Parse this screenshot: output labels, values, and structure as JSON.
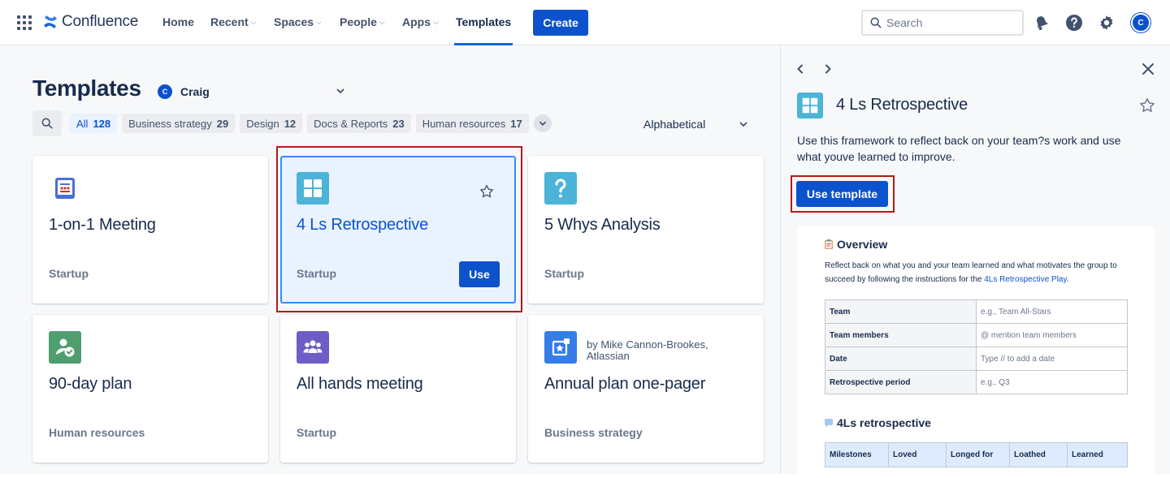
{
  "nav": {
    "logo_text": "Confluence",
    "items": [
      {
        "label": "Home"
      },
      {
        "label": "Recent"
      },
      {
        "label": "Spaces"
      },
      {
        "label": "People"
      },
      {
        "label": "Apps"
      },
      {
        "label": "Templates"
      }
    ],
    "create_label": "Create",
    "search_placeholder": "Search",
    "avatar_initial": "C"
  },
  "page": {
    "title": "Templates",
    "space_avatar": "C",
    "space_name": "Craig",
    "sort_label": "Alphabetical"
  },
  "filters": [
    {
      "label": "All",
      "count": "128"
    },
    {
      "label": "Business strategy",
      "count": "29"
    },
    {
      "label": "Design",
      "count": "12"
    },
    {
      "label": "Docs & Reports",
      "count": "23"
    },
    {
      "label": "Human resources",
      "count": "17"
    }
  ],
  "cards": [
    {
      "title": "1-on-1 Meeting",
      "category": "Startup",
      "icon": "meeting-board-icon"
    },
    {
      "title": "4 Ls Retrospective",
      "category": "Startup",
      "icon": "grid-icon",
      "use_label": "Use"
    },
    {
      "title": "5 Whys Analysis",
      "category": "Startup",
      "icon": "question-icon"
    },
    {
      "title": "90-day plan",
      "category": "Human resources",
      "icon": "person-check-icon"
    },
    {
      "title": "All hands meeting",
      "category": "Startup",
      "icon": "people-icon"
    },
    {
      "title": "Annual plan one-pager",
      "category": "Business strategy",
      "icon": "star-board-icon",
      "author": "by Mike Cannon-Brookes, Atlassian"
    }
  ],
  "panel": {
    "title": "4 Ls Retrospective",
    "description": "Use this framework to reflect back on your team?s work and use what youve learned to improve.",
    "use_template_label": "Use template",
    "preview": {
      "overview_heading": "Overview",
      "overview_text_1": "Reflect back on what you and your team learned and what motivates the group to succeed by following the instructions for the ",
      "overview_link": "4Ls Retrospective Play",
      "overview_text_2": ".",
      "table": [
        {
          "key": "Team",
          "value": "e.g., Team All-Stars"
        },
        {
          "key": "Team members",
          "value": "@ mention team members"
        },
        {
          "key": "Date",
          "value": "Type // to add a date"
        },
        {
          "key": "Retrospective period",
          "value": "e.g., Q3"
        }
      ],
      "retro_heading": "4Ls retrospective",
      "retro_columns": [
        "Milestones",
        "Loved",
        "Longed for",
        "Loathed",
        "Learned"
      ]
    }
  },
  "colors": {
    "brand": "#0c52cc",
    "highlight": "#b3191c",
    "selected_bg": "#e9f2ff"
  }
}
